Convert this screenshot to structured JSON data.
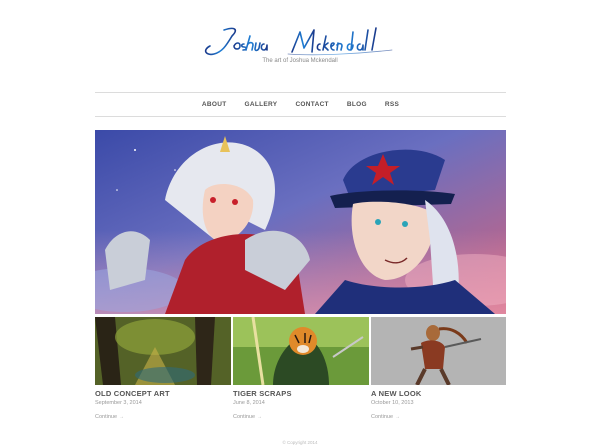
{
  "site": {
    "logo_text": "Joshua Mckendall",
    "tagline": "The art of Joshua Mckendall",
    "brand_color": "#1a6fc4"
  },
  "nav": {
    "items": [
      {
        "label": "ABOUT"
      },
      {
        "label": "GALLERY"
      },
      {
        "label": "CONTACT"
      },
      {
        "label": "BLOG"
      },
      {
        "label": "RSS"
      }
    ]
  },
  "posts": [
    {
      "title": "OLD CONCEPT ART",
      "date": "September 3, 2014",
      "more": "Continue"
    },
    {
      "title": "TIGER SCRAPS",
      "date": "June 8, 2014",
      "more": "Continue"
    },
    {
      "title": "A NEW LOOK",
      "date": "October 10, 2013",
      "more": "Continue"
    }
  ],
  "footer": {
    "copyright": "© Copyright 2014"
  }
}
